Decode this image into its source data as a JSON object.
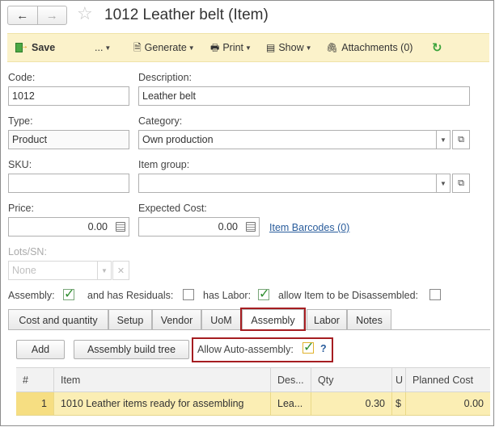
{
  "window": {
    "title": "1012 Leather belt (Item)"
  },
  "toolbar": {
    "save": "Save",
    "more": "...",
    "generate": "Generate",
    "print": "Print",
    "show": "Show",
    "attachments": "Attachments (0)"
  },
  "form": {
    "code_label": "Code:",
    "code_value": "1012",
    "description_label": "Description:",
    "description_value": "Leather belt",
    "type_label": "Type:",
    "type_value": "Product",
    "category_label": "Category:",
    "category_value": "Own production",
    "sku_label": "SKU:",
    "sku_value": "",
    "item_group_label": "Item group:",
    "item_group_value": "",
    "price_label": "Price:",
    "price_value": "0.00",
    "expected_cost_label": "Expected Cost:",
    "expected_cost_value": "0.00",
    "item_barcodes_link": "Item Barcodes (0)",
    "lots_label": "Lots/SN:",
    "lots_placeholder": "None"
  },
  "flags": {
    "assembly_label": "Assembly:",
    "assembly_checked": true,
    "has_residuals_label": "and has Residuals:",
    "has_residuals_checked": false,
    "has_labor_label": "has Labor:",
    "has_labor_checked": true,
    "disassemble_label": "allow Item to be Disassembled:",
    "disassemble_checked": false
  },
  "tabs": [
    {
      "label": "Cost and quantity"
    },
    {
      "label": "Setup"
    },
    {
      "label": "Vendor"
    },
    {
      "label": "UoM"
    },
    {
      "label": "Assembly",
      "active": true
    },
    {
      "label": "Labor"
    },
    {
      "label": "Notes"
    }
  ],
  "assembly": {
    "add_button": "Add",
    "build_tree_button": "Assembly build tree",
    "auto_assembly_label": "Allow Auto-assembly:",
    "auto_assembly_checked": true,
    "help": "?",
    "columns": [
      "#",
      "Item",
      "Des...",
      "Qty",
      "U",
      "Planned Cost"
    ],
    "rows": [
      {
        "num": "1",
        "item": "1010 Leather items ready for assembling",
        "description": "Lea...",
        "qty": "0.30",
        "unit": "$",
        "planned_cost": "0.00"
      }
    ]
  },
  "colors": {
    "toolbar_bg": "#fbf2ca",
    "highlight_border": "#a51d21",
    "link": "#2a5d9c",
    "selected_row": "#fbeeb4",
    "check": "#2f8f2f"
  },
  "icons": {
    "back": "arrow-left-icon",
    "forward": "arrow-right-icon",
    "favorite": "star-icon",
    "save": "save-icon",
    "generate": "generate-icon",
    "print": "printer-icon",
    "show": "report-icon",
    "attachments": "paperclip-icon",
    "refresh": "refresh-icon"
  }
}
